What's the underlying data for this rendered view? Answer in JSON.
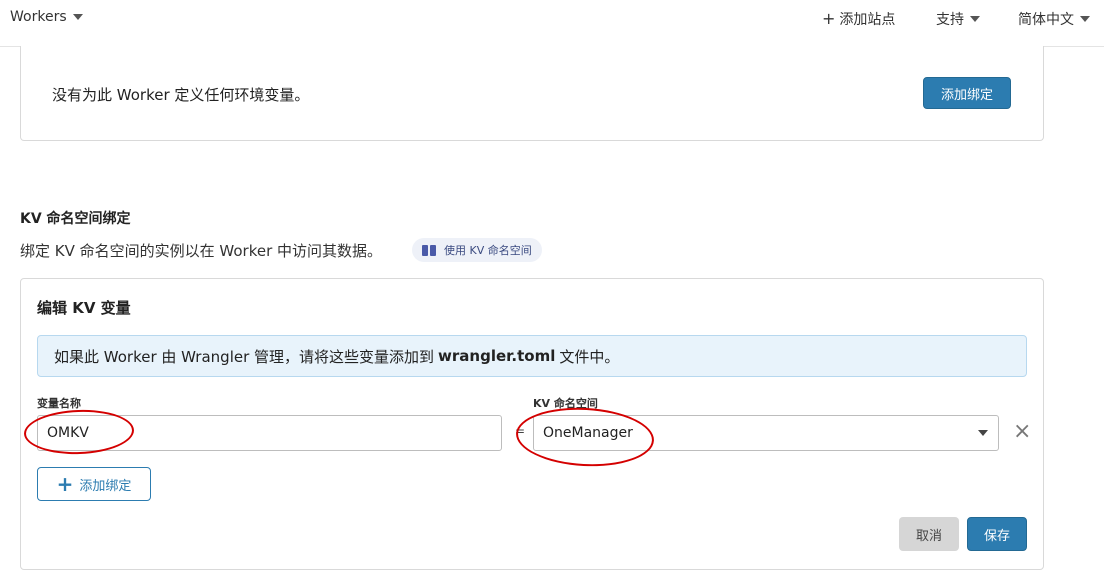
{
  "topbar": {
    "workers_label": "Workers",
    "add_site_label": "添加站点",
    "support_label": "支持",
    "language_label": "简体中文"
  },
  "env_vars": {
    "empty_message": "没有为此 Worker 定义任何环境变量。",
    "add_binding_label": "添加绑定"
  },
  "kv_section": {
    "title": "KV 命名空间绑定",
    "description": "绑定 KV 命名空间的实例以在 Worker 中访问其数据。",
    "doc_link_label": "使用 KV 命名空间"
  },
  "kv_editor": {
    "title": "编辑 KV 变量",
    "info_prefix": "如果此 Worker 由 Wrangler 管理，请将这些变量添加到",
    "info_file": "wrangler.toml",
    "info_suffix": "文件中。",
    "variable_name_label": "变量名称",
    "variable_name_value": "OMKV",
    "namespace_label": "KV 命名空间",
    "namespace_value": "OneManager",
    "equals": "=",
    "add_binding_label": "添加绑定",
    "cancel_label": "取消",
    "save_label": "保存"
  },
  "colors": {
    "primary": "#2c7cb0",
    "annotation": "#d40000",
    "info_bg": "#e8f3fb"
  }
}
